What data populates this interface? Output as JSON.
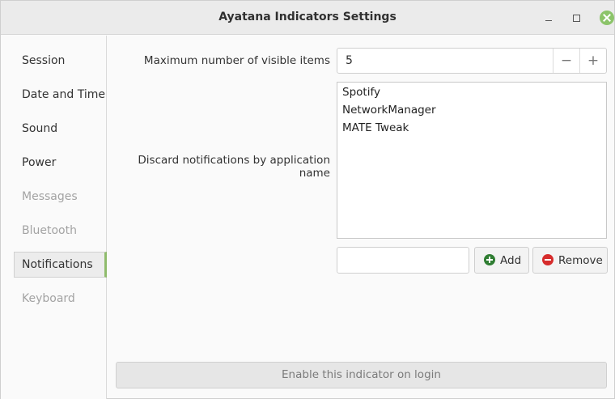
{
  "window": {
    "title": "Ayatana Indicators Settings",
    "close_color": "#8cc46a"
  },
  "sidebar": {
    "items": [
      {
        "label": "Session",
        "state": "normal"
      },
      {
        "label": "Date and Time",
        "state": "normal"
      },
      {
        "label": "Sound",
        "state": "normal"
      },
      {
        "label": "Power",
        "state": "normal"
      },
      {
        "label": "Messages",
        "state": "disabled"
      },
      {
        "label": "Bluetooth",
        "state": "disabled"
      },
      {
        "label": "Notifications",
        "state": "selected"
      },
      {
        "label": "Keyboard",
        "state": "disabled"
      }
    ],
    "accent_color": "#8fbb6c"
  },
  "main": {
    "max_items_label": "Maximum number of visible items",
    "max_items_value": "5",
    "minus_symbol": "−",
    "plus_symbol": "+",
    "discard_label": "Discard notifications by application name",
    "app_list": [
      "Spotify",
      "NetworkManager",
      "MATE Tweak"
    ],
    "entry_value": "",
    "add_label": "Add",
    "remove_label": "Remove",
    "enable_label": "Enable this indicator on login"
  }
}
